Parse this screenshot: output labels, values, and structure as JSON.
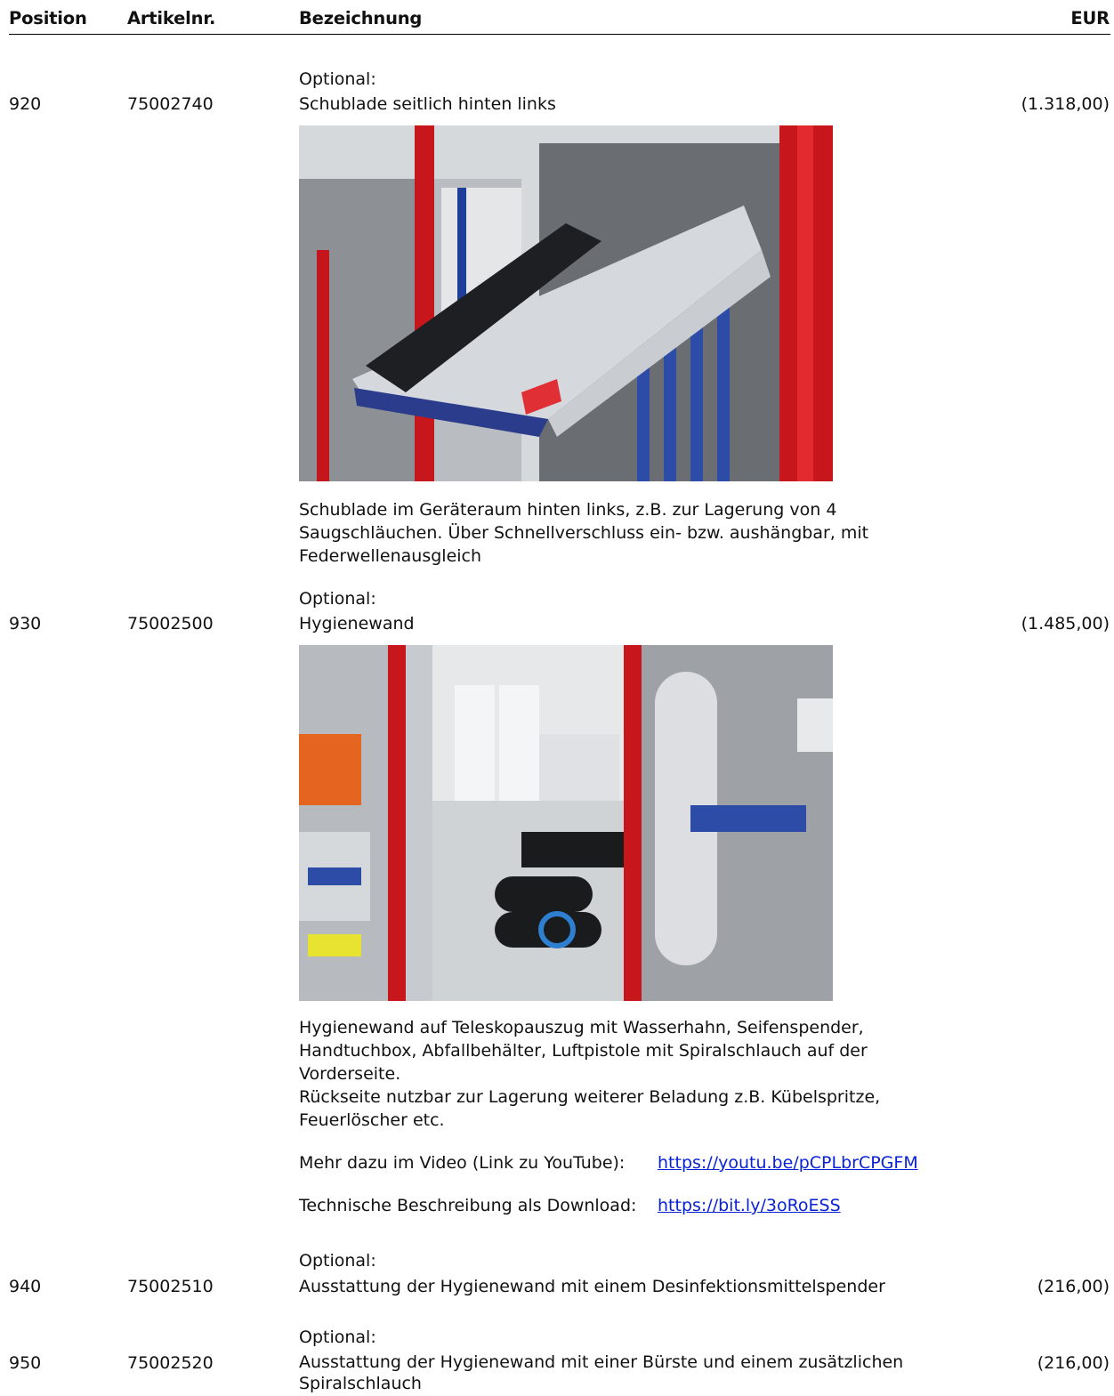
{
  "header": {
    "position": "Position",
    "article": "Artikelnr.",
    "description": "Bezeichnung",
    "currency": "EUR"
  },
  "items": [
    {
      "optional": "Optional:",
      "position": "920",
      "article": "75002740",
      "title": "Schublade seitlich hinten links",
      "price": "(1.318,00)",
      "description": "Schublade im Geräteraum hinten links, z.B. zur Lagerung von 4\nSaugschläuchen. Über Schnellverschluss ein- bzw. aushängbar, mit\nFederwellenausgleich"
    },
    {
      "optional": "Optional:",
      "position": "930",
      "article": "75002500",
      "title": "Hygienewand",
      "price": "(1.485,00)",
      "description": "Hygienewand auf Teleskopauszug mit Wasserhahn, Seifenspender,\nHandtuchbox, Abfallbehälter, Luftpistole mit Spiralschlauch auf der\nVorderseite.\nRückseite nutzbar zur Lagerung weiterer Beladung z.B. Kübelspritze,\nFeuerlöscher etc.",
      "video_label": "Mehr dazu im Video (Link zu YouTube):",
      "video_link": "https://youtu.be/pCPLbrCPGFM",
      "download_label": "Technische Beschreibung als Download:",
      "download_link": "https://bit.ly/3oRoESS"
    },
    {
      "optional": "Optional:",
      "position": "940",
      "article": "75002510",
      "title": "Ausstattung der Hygienewand mit einem Desinfektionsmittelspender",
      "price": "(216,00)"
    },
    {
      "optional": "Optional:",
      "position": "950",
      "article": "75002520",
      "title": "Ausstattung der Hygienewand mit einer Bürste und einem zusätzlichen\nSpiralschlauch",
      "price": "(216,00)"
    }
  ]
}
